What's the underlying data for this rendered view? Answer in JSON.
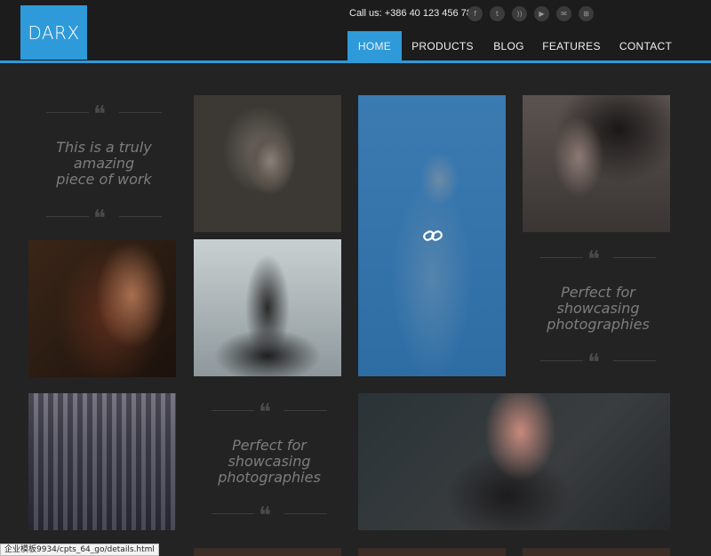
{
  "header": {
    "logo": "DARX",
    "call_us": "Call us: +386 40 123 456 789",
    "social": [
      {
        "icon": "facebook-icon",
        "glyph": "f"
      },
      {
        "icon": "twitter-icon",
        "glyph": "t"
      },
      {
        "icon": "rss-icon",
        "glyph": "))"
      },
      {
        "icon": "youtube-icon",
        "glyph": "▶"
      },
      {
        "icon": "mail-icon",
        "glyph": "✉"
      },
      {
        "icon": "windows-icon",
        "glyph": "⊞"
      }
    ],
    "nav": [
      "HOME",
      "PRODUCTS",
      "BLOG",
      "FEATURES",
      "CONTACT"
    ],
    "active_nav": "HOME"
  },
  "quotes": [
    {
      "text": "This is a truly\namazing\npiece of work"
    },
    {
      "text": "Perfect for\nshowcasing\nphotographies"
    },
    {
      "text": "Perfect for\nshowcasing\nphotographies"
    }
  ],
  "status_bar": {
    "text": "企业模板9934/cpts_64_go/details.html"
  },
  "colors": {
    "accent": "#2f9ad9",
    "background": "#232323",
    "header": "#1c1c1c"
  }
}
